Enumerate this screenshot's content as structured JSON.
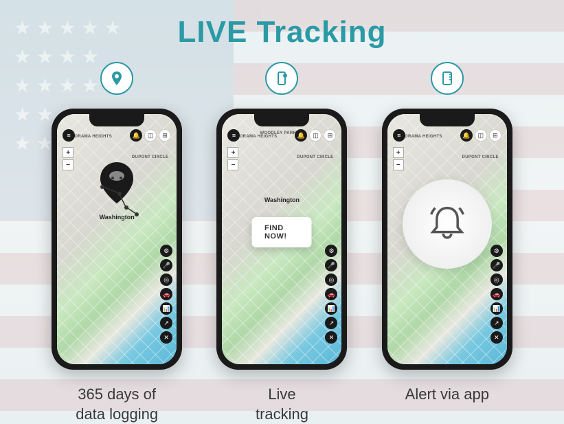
{
  "title": "LIVE Tracking",
  "map": {
    "city": "Washington",
    "areas": [
      "KALORAMA HEIGHTS",
      "WOODLEY PARK",
      "DUPONT CIRCLE"
    ]
  },
  "phone1": {
    "find_label": "",
    "caption_line1": "365 days of",
    "caption_line2": "data logging"
  },
  "phone2": {
    "find_label": "FIND NOW!",
    "caption_line1": "Live",
    "caption_line2": "tracking"
  },
  "phone3": {
    "caption_line1": "Alert via app",
    "caption_line2": ""
  },
  "icons": {
    "feature1": "route-icon",
    "feature2": "device-icon",
    "feature3": "phone-alert-icon"
  }
}
